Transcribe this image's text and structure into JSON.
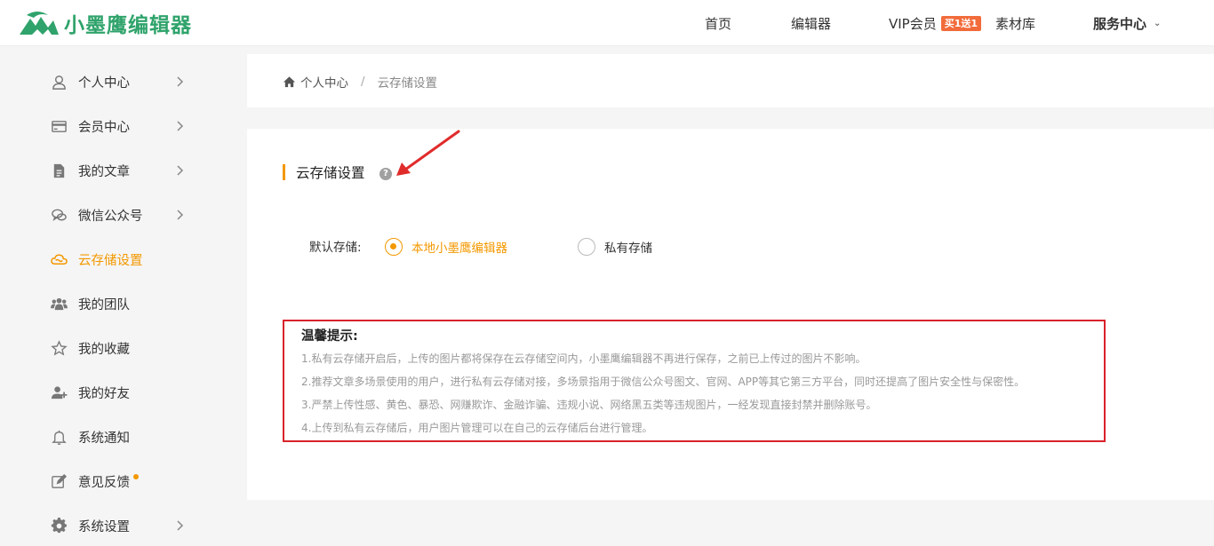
{
  "header": {
    "logo_text": "小墨鹰编辑器",
    "nav": {
      "home": "首页",
      "editor": "编辑器",
      "vip": "VIP会员",
      "vip_badge": "买1送1",
      "material": "素材库",
      "service": "服务中心"
    }
  },
  "sidebar": {
    "items": [
      {
        "label": "个人中心",
        "icon": "user-icon"
      },
      {
        "label": "会员中心",
        "icon": "card-icon"
      },
      {
        "label": "我的文章",
        "icon": "document-icon"
      },
      {
        "label": "微信公众号",
        "icon": "chat-icon"
      },
      {
        "label": "云存储设置",
        "icon": "cloud-icon",
        "active": true
      },
      {
        "label": "我的团队",
        "icon": "team-icon"
      },
      {
        "label": "我的收藏",
        "icon": "star-icon"
      },
      {
        "label": "我的好友",
        "icon": "add-friend-icon"
      },
      {
        "label": "系统通知",
        "icon": "bell-icon"
      },
      {
        "label": "意见反馈",
        "icon": "edit-icon"
      },
      {
        "label": "系统设置",
        "icon": "gear-icon"
      }
    ]
  },
  "breadcrumb": {
    "home": "个人中心",
    "separator": "/",
    "current": "云存储设置"
  },
  "main": {
    "title": "云存储设置",
    "help": "?",
    "default_storage_label": "默认存储:",
    "options": {
      "local": "本地小墨鹰编辑器",
      "private": "私有存储"
    },
    "selected": "local",
    "tips_title": "温馨提示:",
    "tips": [
      "1.私有云存储开启后，上传的图片都将保存在云存储空间内，小墨鹰编辑器不再进行保存，之前已上传过的图片不影响。",
      "2.推荐文章多场景使用的用户，进行私有云存储对接，多场景指用于微信公众号图文、官网、APP等其它第三方平台，同时还提高了图片安全性与保密性。",
      "3.严禁上传性感、黄色、暴恐、网赚欺诈、金融诈骗、违规小说、网络黑五类等违规图片，一经发现直接封禁并删除账号。",
      "4.上传到私有云存储后，用户图片管理可以在自己的云存储后台进行管理。"
    ]
  },
  "colors": {
    "brand_green": "#2fa36b",
    "accent_orange": "#f39800",
    "tips_border_red": "#d9222a",
    "vip_badge": "#f26b3a"
  }
}
